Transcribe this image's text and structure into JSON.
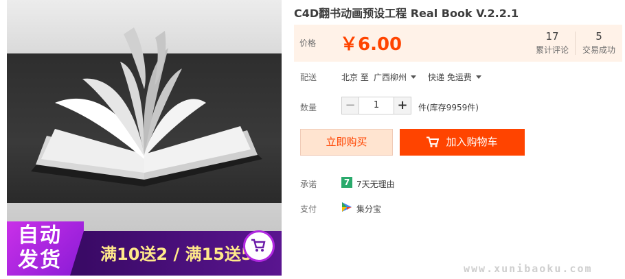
{
  "product": {
    "title": "C4D翻书动画预设工程 Real Book V.2.2.1",
    "image_alt": "open book with flipping pages"
  },
  "promo": {
    "auto_line1": "自动",
    "auto_line2": "发货",
    "offer": "满10送2 / 满15送5"
  },
  "price": {
    "label": "价格",
    "value": "￥6.00",
    "reviews_count": "17",
    "reviews_label": "累计评论",
    "deals_count": "5",
    "deals_label": "交易成功"
  },
  "shipping": {
    "label": "配送",
    "from": "北京 至",
    "to": "广西柳州",
    "method": "快递 免运费"
  },
  "quantity": {
    "label": "数量",
    "value": "1",
    "stock": "件(库存9959件)"
  },
  "actions": {
    "buy_now": "立即购买",
    "add_to_cart": "加入购物车"
  },
  "promise": {
    "label": "承诺",
    "badge": "7",
    "text": "7天无理由"
  },
  "payment": {
    "label": "支付",
    "text": "集分宝"
  },
  "watermark": "www.xunibaoku.com",
  "colors": {
    "accent": "#ff4400",
    "price_bg": "#fff2e8",
    "promo_purple": "#b027e0",
    "promise_green": "#2aaa6c"
  }
}
